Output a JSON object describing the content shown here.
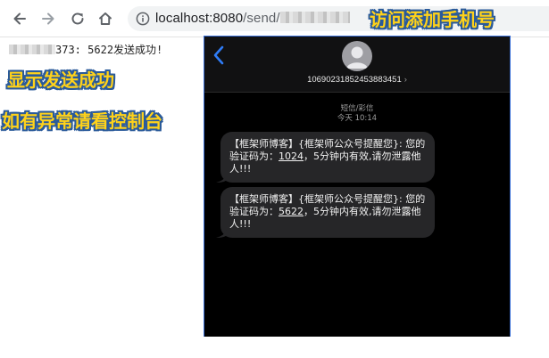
{
  "browser": {
    "url_host": "localhost:8080",
    "url_path": "/send/",
    "nav": {
      "back": "arrow-left-icon",
      "forward": "arrow-right-icon",
      "reload": "reload-icon",
      "home": "home-icon",
      "site_info": "info-icon"
    }
  },
  "annotations": {
    "url_note": "访问添加手机号",
    "success_note": "显示发送成功",
    "error_note": "如有异常请看控制台"
  },
  "result": {
    "phone_suffix": "373:",
    "message": "5622发送成功!"
  },
  "phone": {
    "sender_number": "10690231852453883451",
    "chevron": "›",
    "message_type": "短信/彩信",
    "time": "今天 10:14",
    "messages": [
      {
        "prefix": "【框架师博客】{框架师公众号提醒您}: 您的验证码为：",
        "code": "1024",
        "suffix": "，5分钟内有效,请勿泄露他人!!!"
      },
      {
        "prefix": "【框架师博客】{框架师公众号提醒您}: 您的验证码为：",
        "code": "5622",
        "suffix": "，5分钟内有效,请勿泄露他人!!!"
      }
    ]
  },
  "colors": {
    "annotation_fill": "#ffd21a",
    "annotation_outline": "#2a5a9a",
    "phone_bg": "#000000",
    "bubble_bg": "#262628",
    "ios_blue": "#2f7cf6"
  }
}
